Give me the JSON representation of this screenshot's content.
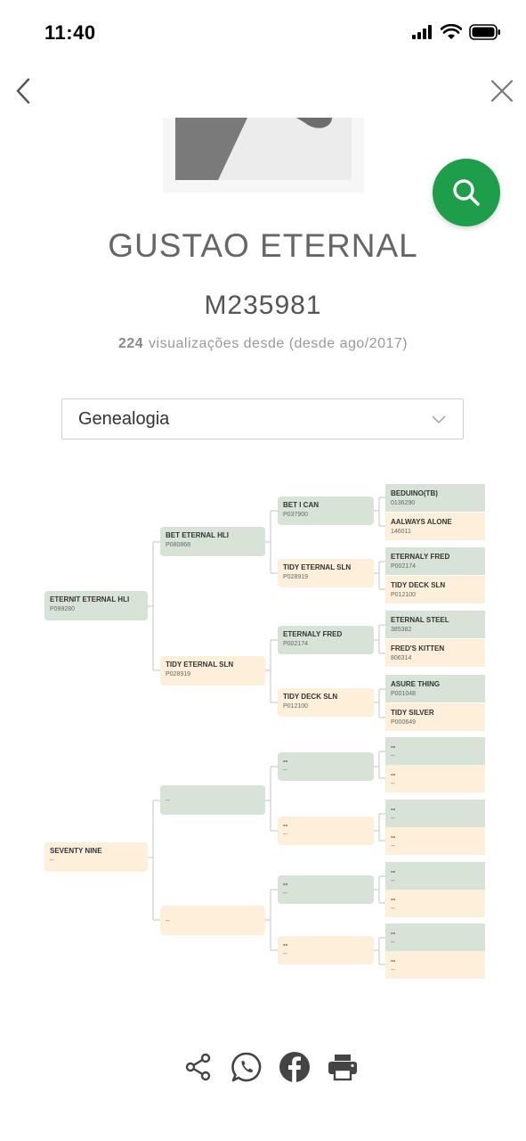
{
  "status_bar": {
    "time": "11:40"
  },
  "horse": {
    "name": "GUSTAO ETERNAL",
    "registration": "M235981",
    "views_count": "224",
    "views_text": "visualizações desde",
    "views_since": "(desde ago/2017)"
  },
  "section_select": {
    "selected": "Genealogia"
  },
  "pedigree": {
    "gen1": [
      {
        "name": "ETERNIT ETERNAL HLI",
        "reg": "P099280"
      },
      {
        "name": "SEVENTY NINE",
        "reg": "--"
      }
    ],
    "gen2": [
      {
        "name": "BET ETERNAL HLI",
        "reg": "P080868"
      },
      {
        "name": "TIDY ETERNAL SLN",
        "reg": "P028919"
      },
      {
        "name": "",
        "reg": "--"
      },
      {
        "name": "",
        "reg": "--"
      }
    ],
    "gen3": [
      {
        "name": "BET I CAN",
        "reg": "P037900"
      },
      {
        "name": "TIDY ETERNAL SLN",
        "reg": "P028919"
      },
      {
        "name": "ETERNALY FRED",
        "reg": "P002174"
      },
      {
        "name": "TIDY DECK SLN",
        "reg": "P012100"
      },
      {
        "name": "--",
        "reg": "--"
      },
      {
        "name": "--",
        "reg": "--"
      },
      {
        "name": "--",
        "reg": "--"
      },
      {
        "name": "--",
        "reg": "--"
      }
    ],
    "gen4": [
      {
        "name": "BEDUINO(TB)",
        "reg": "0136290"
      },
      {
        "name": "AALWAYS ALONE",
        "reg": "146011"
      },
      {
        "name": "ETERNALY FRED",
        "reg": "P002174"
      },
      {
        "name": "TIDY DECK SLN",
        "reg": "P012100"
      },
      {
        "name": "ETERNAL STEEL",
        "reg": "385382"
      },
      {
        "name": "FRED'S KITTEN",
        "reg": "806314"
      },
      {
        "name": "ASURE THING",
        "reg": "P001048"
      },
      {
        "name": "TIDY SILVER",
        "reg": "P000649"
      },
      {
        "name": "--",
        "reg": "--"
      },
      {
        "name": "--",
        "reg": "--"
      },
      {
        "name": "--",
        "reg": "--"
      },
      {
        "name": "--",
        "reg": "--"
      },
      {
        "name": "--",
        "reg": "--"
      },
      {
        "name": "--",
        "reg": "--"
      },
      {
        "name": "--",
        "reg": "--"
      },
      {
        "name": "--",
        "reg": "--"
      }
    ]
  },
  "share_icons": [
    "share-icon",
    "whatsapp-icon",
    "facebook-icon",
    "print-icon"
  ],
  "colors": {
    "accent": "#1e9e4a",
    "sire_box": "#d8e3d8",
    "dam_box": "#fdefda"
  }
}
